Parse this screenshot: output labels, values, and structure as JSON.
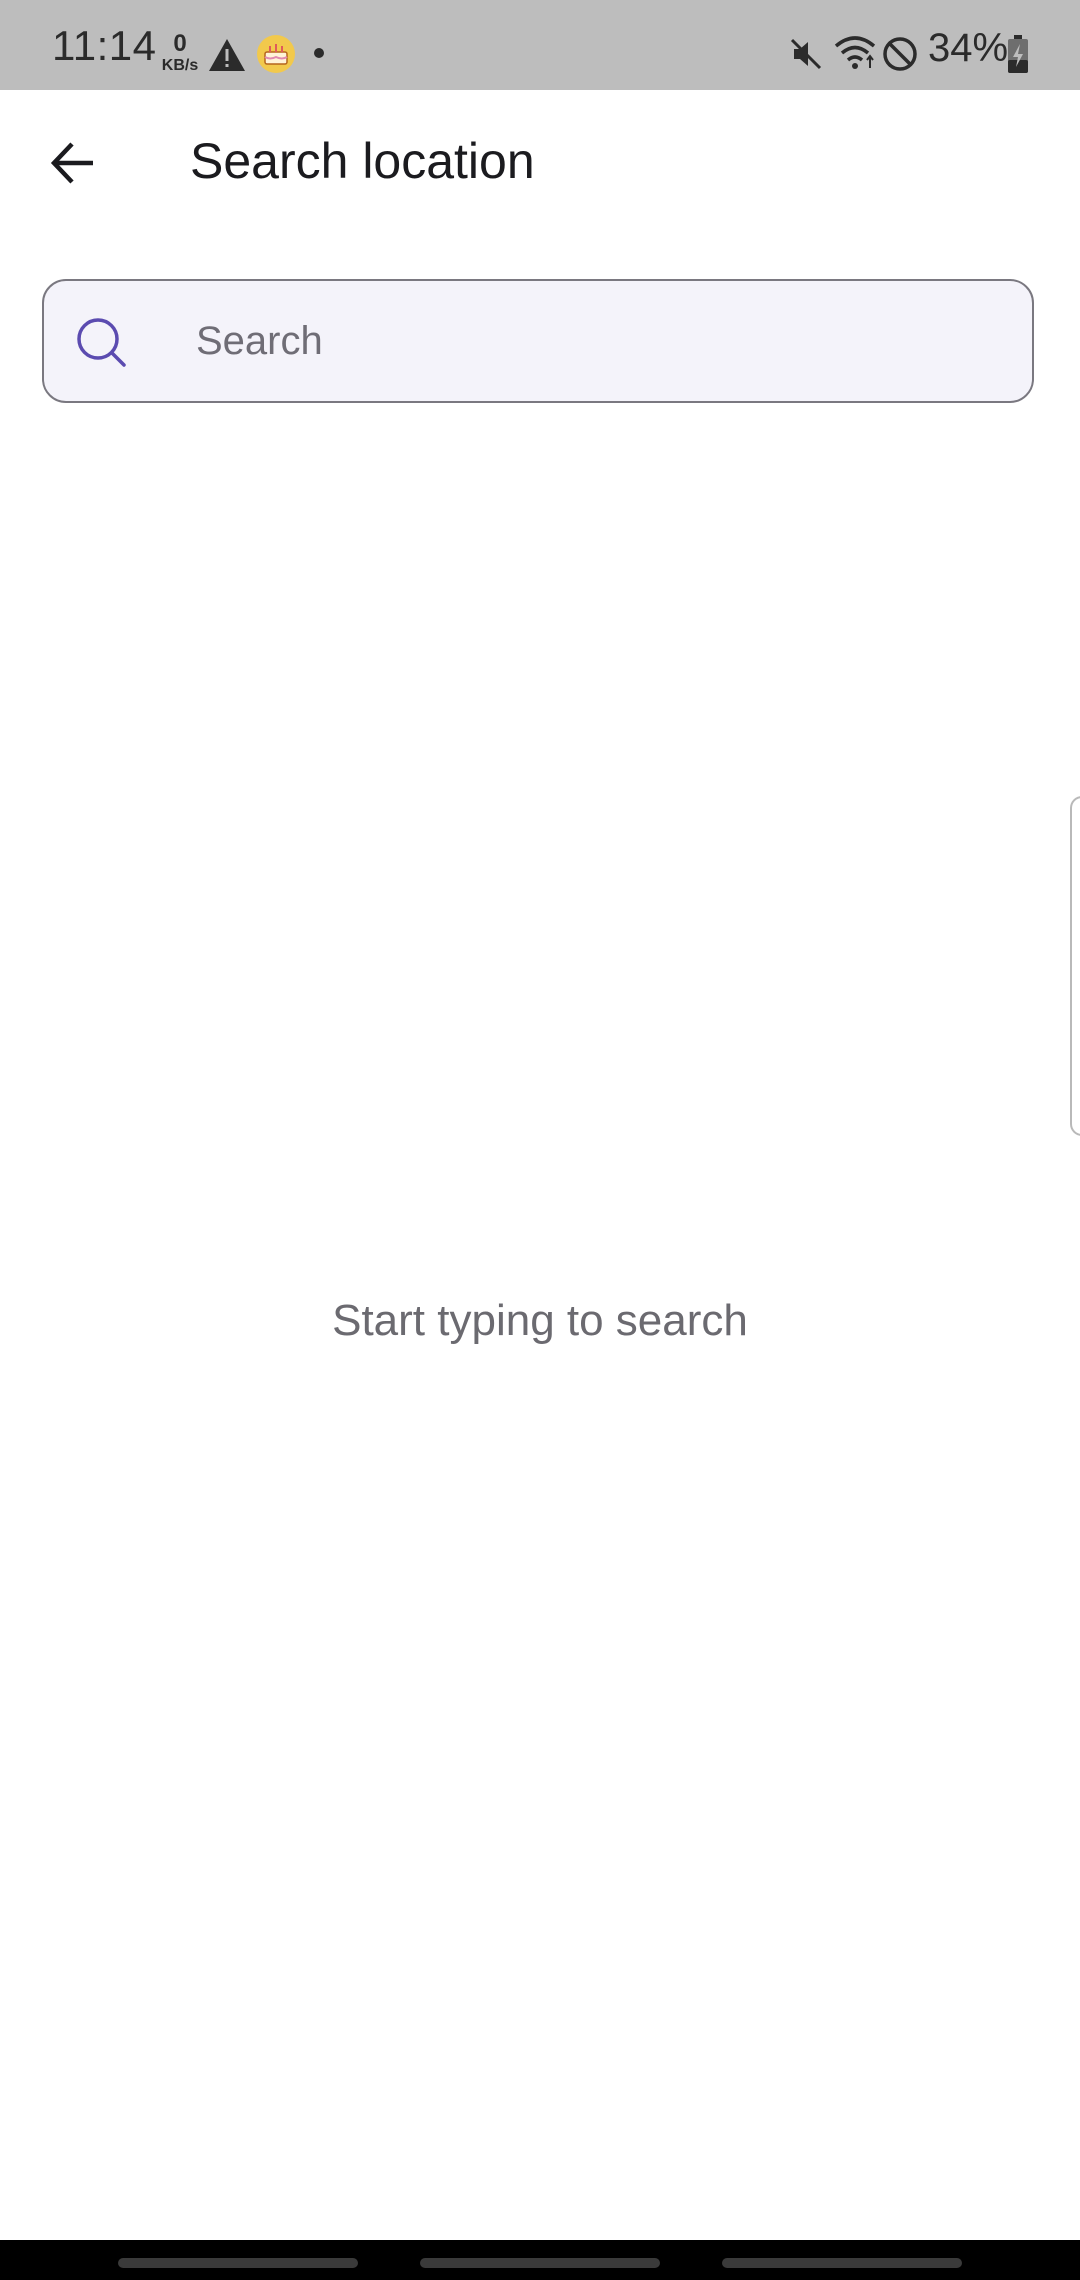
{
  "status_bar": {
    "time": "11:14",
    "net_speed_value": "0",
    "net_speed_unit": "KB/s",
    "battery_percent": "34%",
    "icons": [
      "warning-icon",
      "cake-notification-icon",
      "mute-icon",
      "wifi-icon",
      "do-not-disturb-icon",
      "battery-charging-icon"
    ]
  },
  "header": {
    "title": "Search location",
    "back_icon": "arrow-back-icon"
  },
  "search": {
    "placeholder": "Search",
    "value": "",
    "icon": "search-icon",
    "accent_color": "#5b4bb0"
  },
  "empty_state": {
    "message": "Start typing to search"
  }
}
